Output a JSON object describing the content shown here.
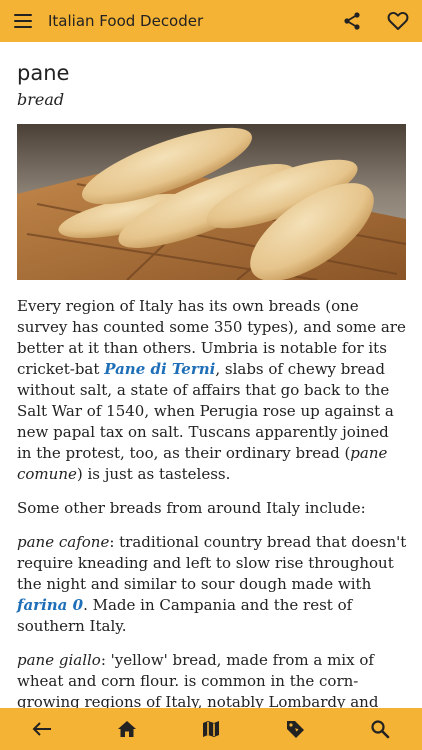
{
  "app": {
    "title": "Italian Food Decoder",
    "accent_color": "#f5b335",
    "link_color": "#1f6fb8"
  },
  "header_icons": [
    "menu-icon",
    "share-icon",
    "heart-icon"
  ],
  "entry": {
    "word": "pane",
    "translation": "bread",
    "photo": "bread-loaves-on-wooden-board"
  },
  "body": {
    "p1": {
      "a": "Every region of Italy has its own breads (one survey has counted some 350 types), and some are better at it than others. Umbria is notable for its cricket-bat ",
      "link": "Pane di Terni",
      "b": ", slabs of chewy bread without salt, a state of affairs that go back to the Salt War of 1540, when Perugia rose up against a new papal tax on salt. Tuscans apparently joined in the protest, too, as their ordinary bread (",
      "term": "pane comune",
      "c": ") is just as tasteless."
    },
    "p2": "Some other breads from around Italy include:",
    "p3": {
      "term": "pane cafone",
      "a": ": traditional country bread that doesn't require kneading and left to slow rise throughout the night and similar to sour dough made with ",
      "link": "farina 0",
      "b": ". Made in Campania and the rest of southern Italy."
    },
    "p4": {
      "term": "pane giallo",
      "a": ": 'yellow' bread, made from a mix of wheat and corn flour. is common in the corn-growing regions of Italy, notably Lombardy and Emilia-Romagna."
    }
  },
  "bottom_nav": [
    "back-arrow-icon",
    "home-icon",
    "map-icon",
    "tag-icon",
    "search-icon"
  ]
}
